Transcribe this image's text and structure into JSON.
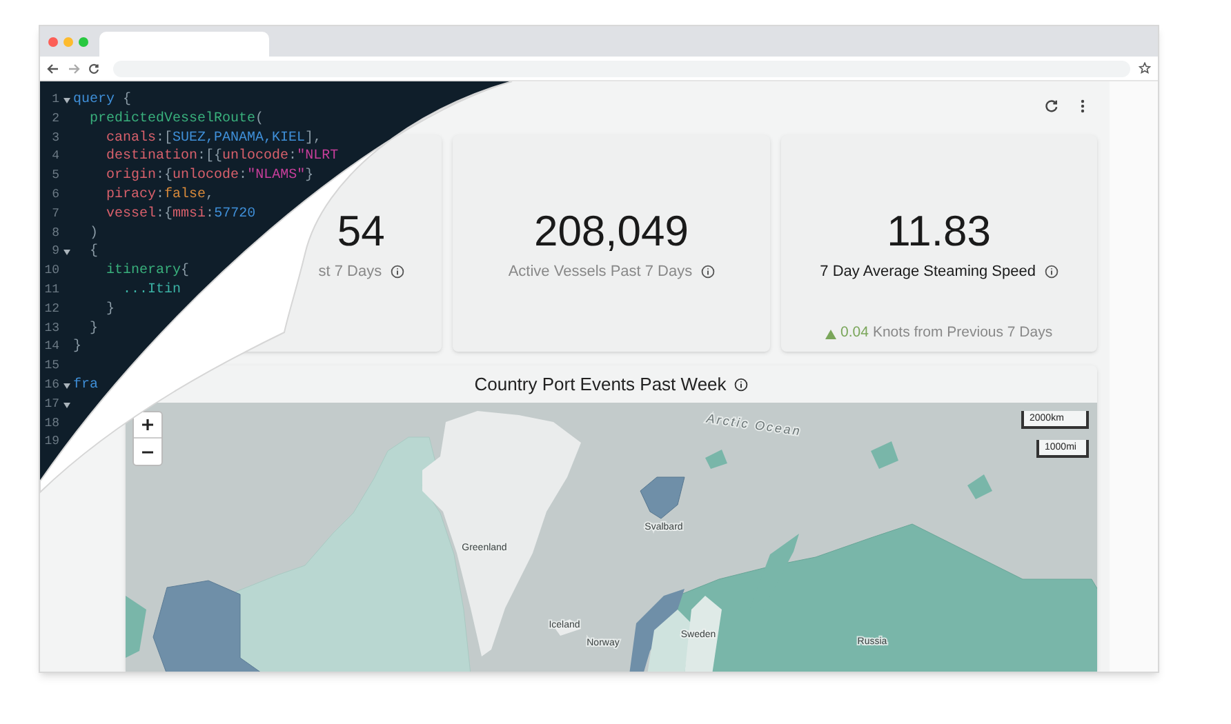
{
  "code": [
    {
      "number": "1",
      "fold": true,
      "tokens": [
        {
          "t": "query",
          "kind": "keyword"
        },
        {
          "t": " {",
          "kind": "punct"
        }
      ]
    },
    {
      "number": "2",
      "fold": false,
      "tokens": [
        {
          "t": "  predictedVesselRoute",
          "kind": "function"
        },
        {
          "t": "(",
          "kind": "punct"
        }
      ]
    },
    {
      "number": "3",
      "fold": false,
      "tokens": [
        {
          "t": "    canals",
          "kind": "field"
        },
        {
          "t": ":[",
          "kind": "punct"
        },
        {
          "t": "SUEZ,PANAMA,KIEL",
          "kind": "enum"
        },
        {
          "t": "],",
          "kind": "punct"
        }
      ]
    },
    {
      "number": "4",
      "fold": false,
      "tokens": [
        {
          "t": "    destination",
          "kind": "field"
        },
        {
          "t": ":[{",
          "kind": "punct"
        },
        {
          "t": "unlocode",
          "kind": "field"
        },
        {
          "t": ":",
          "kind": "punct"
        },
        {
          "t": "\"NLRT",
          "kind": "string"
        }
      ]
    },
    {
      "number": "5",
      "fold": false,
      "tokens": [
        {
          "t": "    origin",
          "kind": "field"
        },
        {
          "t": ":{",
          "kind": "punct"
        },
        {
          "t": "unlocode",
          "kind": "field"
        },
        {
          "t": ":",
          "kind": "punct"
        },
        {
          "t": "\"NLAMS\"",
          "kind": "string"
        },
        {
          "t": "}",
          "kind": "punct"
        }
      ]
    },
    {
      "number": "6",
      "fold": false,
      "tokens": [
        {
          "t": "    piracy",
          "kind": "field"
        },
        {
          "t": ":",
          "kind": "punct"
        },
        {
          "t": "false",
          "kind": "bool"
        },
        {
          "t": ",",
          "kind": "punct"
        }
      ]
    },
    {
      "number": "7",
      "fold": false,
      "tokens": [
        {
          "t": "    vessel",
          "kind": "field"
        },
        {
          "t": ":{",
          "kind": "punct"
        },
        {
          "t": "mmsi",
          "kind": "field"
        },
        {
          "t": ":",
          "kind": "punct"
        },
        {
          "t": "57720",
          "kind": "enum"
        }
      ]
    },
    {
      "number": "8",
      "fold": false,
      "tokens": [
        {
          "t": "  )",
          "kind": "punct"
        }
      ]
    },
    {
      "number": "9",
      "fold": true,
      "tokens": [
        {
          "t": "  {",
          "kind": "punct"
        }
      ]
    },
    {
      "number": "10",
      "fold": false,
      "tokens": [
        {
          "t": "    itinerary",
          "kind": "function"
        },
        {
          "t": "{",
          "kind": "punct"
        }
      ]
    },
    {
      "number": "11",
      "fold": false,
      "tokens": [
        {
          "t": "      ...Itin",
          "kind": "fragment"
        }
      ]
    },
    {
      "number": "12",
      "fold": false,
      "tokens": [
        {
          "t": "    }",
          "kind": "punct"
        }
      ]
    },
    {
      "number": "13",
      "fold": false,
      "tokens": [
        {
          "t": "  }",
          "kind": "punct"
        }
      ]
    },
    {
      "number": "14",
      "fold": false,
      "tokens": [
        {
          "t": "}",
          "kind": "punct"
        }
      ]
    },
    {
      "number": "15",
      "fold": false
    },
    {
      "number": "16",
      "fold": true,
      "tokens": [
        {
          "t": "fra",
          "kind": "keyword"
        }
      ]
    },
    {
      "number": "17",
      "fold": true
    },
    {
      "number": "18",
      "fold": false
    },
    {
      "number": "19",
      "fold": false
    }
  ],
  "stats": [
    {
      "value": "54",
      "label": "st 7 Days",
      "emphasis": false
    },
    {
      "value": "208,049",
      "label": "Active Vessels Past 7 Days",
      "emphasis": false
    },
    {
      "value": "11.83",
      "label": "7 Day Average Steaming Speed",
      "emphasis": true,
      "delta": {
        "kind": "up",
        "value": "0.04",
        "text": "Knots from Previous 7 Days"
      }
    }
  ],
  "map_card": {
    "title": "Country Port Events Past Week",
    "scale": [
      "2000km",
      "1000mi"
    ],
    "labels": [
      {
        "text": "Arctic Ocean",
        "kind": "ocean"
      },
      {
        "text": "Greenland",
        "kind": "place"
      },
      {
        "text": "Iceland",
        "kind": "place"
      },
      {
        "text": "Svalbard",
        "kind": "place"
      },
      {
        "text": "Sweden",
        "kind": "place"
      },
      {
        "text": "Norway",
        "kind": "place"
      },
      {
        "text": "Russia",
        "kind": "place"
      }
    ]
  }
}
